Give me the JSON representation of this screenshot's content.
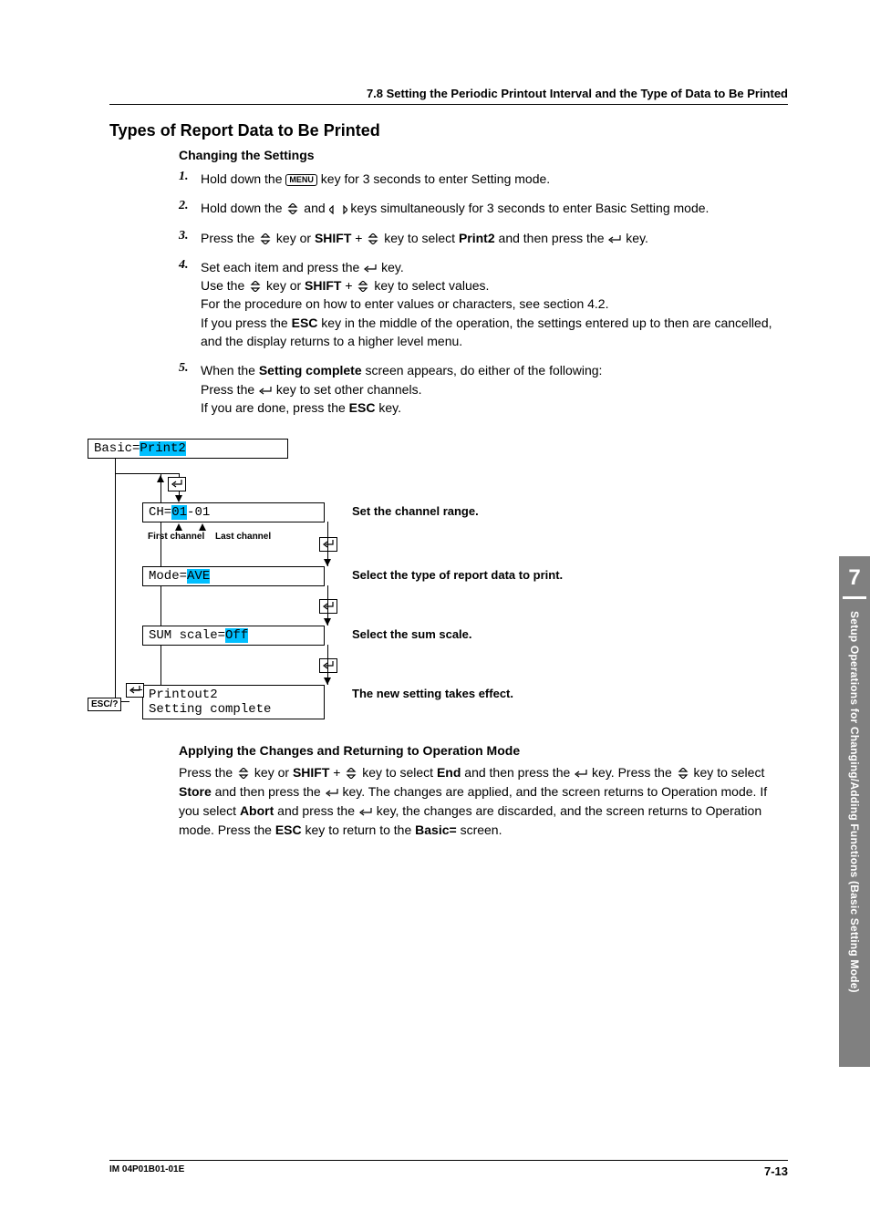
{
  "header": {
    "section": "7.8  Setting the Periodic Printout Interval and the Type of Data to Be Printed"
  },
  "headings": {
    "main": "Types of Report Data to Be Printed",
    "changing": "Changing the Settings",
    "applying": "Applying the Changes and Returning to Operation Mode"
  },
  "steps": {
    "n1": "1.",
    "s1a": "Hold down the ",
    "s1_menu": "MENU",
    "s1b": " key for 3 seconds to enter Setting mode.",
    "n2": "2.",
    "s2a": "Hold down the ",
    "s2b": " and ",
    "s2c": " keys simultaneously for 3 seconds to enter Basic Setting mode.",
    "n3": "3.",
    "s3a": "Press the ",
    "s3b": " key or ",
    "s3_shift": "SHIFT",
    "s3c": " + ",
    "s3d": " key to select ",
    "s3_print2": "Print2",
    "s3e": " and then press the ",
    "s3f": " key.",
    "n4": "4.",
    "s4a": "Set each item and press the ",
    "s4b": " key.",
    "s4c": "Use the ",
    "s4d": " key or ",
    "s4_shift": "SHIFT",
    "s4e": " + ",
    "s4f": " key to select values.",
    "s4g": "For the procedure on how to enter values or characters, see section 4.2.",
    "s4h1": "If you press the ",
    "s4_esc": "ESC",
    "s4h2": " key in the middle of the operation, the settings entered up to then are cancelled, and the display returns to a higher level menu.",
    "n5": "5.",
    "s5a": "When the ",
    "s5_sc": "Setting complete",
    "s5b": " screen appears, do either of the following:",
    "s5c": "Press the ",
    "s5d": " key to set other channels.",
    "s5e": "If you are done, press the ",
    "s5_esc": "ESC",
    "s5f": " key."
  },
  "diagram": {
    "basic_label": "Basic=",
    "basic_val": "Print2",
    "ch_label": "CH=",
    "ch_v1": "01",
    "ch_dash": "-",
    "ch_v2": "01",
    "mode_label": "Mode=",
    "mode_val": "AVE",
    "sum_label": "SUM scale=",
    "sum_val": "Off",
    "printout": "Printout2",
    "complete": "Setting complete",
    "first": "First channel",
    "last": "Last channel",
    "esc": "ESC/?",
    "cap1": "Set the channel range.",
    "cap2": "Select the type of report data to print.",
    "cap3": "Select the sum scale.",
    "cap4": "The new setting takes effect."
  },
  "applying": {
    "p1a": "Press the ",
    "p1b": " key or ",
    "p1_shift": "SHIFT",
    "p1c": " + ",
    "p1d": " key to select ",
    "p1_end": "End",
    "p1e": " and then press the ",
    "p1f": " key. Press the ",
    "p1g": " key to select ",
    "p1_store": "Store",
    "p1h": " and then press the ",
    "p1i": " key. The changes are applied, and the screen returns to Operation mode. If you select ",
    "p1_abort": "Abort",
    "p1j": " and press the ",
    "p1k": " key, the changes are discarded, and the screen returns to Operation mode. Press the ",
    "p1_esc": "ESC",
    "p1l": " key to return to the ",
    "p1_basic": "Basic=",
    "p1m": " screen."
  },
  "sidebar": {
    "chapter": "7",
    "title": "Setup Operations for Changing/Adding Functions (Basic Setting Mode)"
  },
  "footer": {
    "doc": "IM 04P01B01-01E",
    "page": "7-13"
  }
}
